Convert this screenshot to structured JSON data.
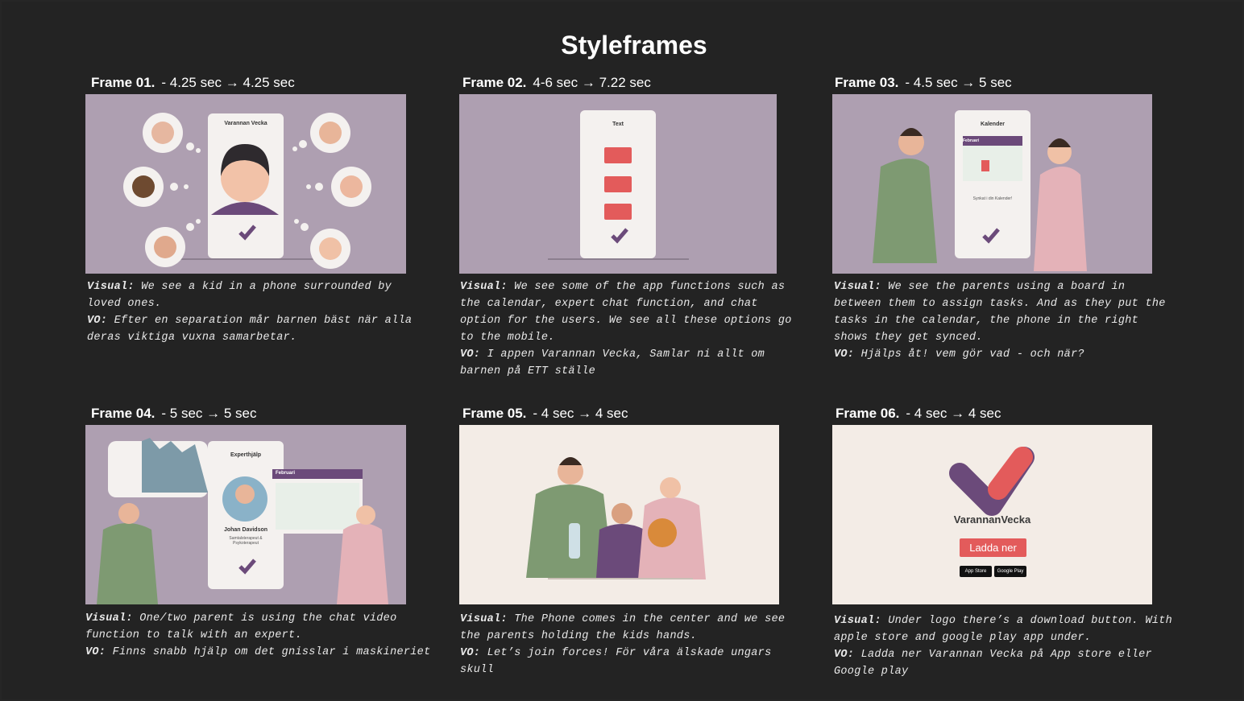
{
  "page": {
    "title": "Styleframes"
  },
  "frames": [
    {
      "number": "Frame 01.",
      "timing": "- 4.25 sec → 4.25 sec",
      "visual_label": "Visual:",
      "visual_text": "We see a kid in a phone surrounded by loved ones.",
      "vo_label": "VO:",
      "vo_text": "Efter en separation mår barnen bäst när alla deras viktiga vuxna samarbetar.",
      "phone_title": "Varannan Vecka"
    },
    {
      "number": "Frame 02.",
      "timing": "4-6 sec → 7.22 sec",
      "visual_label": "Visual:",
      "visual_text": "We see some of the app functions such as the calendar, expert chat function, and chat option for the users. We see all these options go to the mobile.",
      "vo_label": "VO:",
      "vo_text": "I appen Varannan Vecka, Samlar ni allt om barnen på ETT ställe",
      "phone_title": "Text"
    },
    {
      "number": "Frame 03.",
      "timing": "- 4.5 sec → 5 sec",
      "visual_label": "Visual:",
      "visual_text": "We see the parents using a board in between them to assign tasks. And as they put the tasks in the calendar, the phone in the right shows they get synced.",
      "vo_label": "VO:",
      "vo_text": "Hjälps åt! vem gör vad - och när?",
      "phone_title": "Kalender",
      "calendar_month": "Februari",
      "sync_text": "Synkat i din Kalender!"
    },
    {
      "number": "Frame 04.",
      "timing": "- 5 sec → 5 sec",
      "visual_label": "Visual:",
      "visual_text": "One/two parent is using the chat video function to talk with an expert.",
      "vo_label": "VO:",
      "vo_text": "Finns snabb hjälp om det gnisslar i maskineriet",
      "phone_title": "Experthjälp",
      "calendar_month": "Februari",
      "expert_name": "Johan Davidson",
      "expert_role": "Samtalsterapeut & Psykoterapeut"
    },
    {
      "number": "Frame 05.",
      "timing": "- 4 sec  → 4 sec",
      "visual_label": "Visual:",
      "visual_text": "The Phone comes in the center and we see the parents holding the kids hands.",
      "vo_label": "VO:",
      "vo_text": "Let’s join forces! För våra älskade ungars skull"
    },
    {
      "number": "Frame 06.",
      "timing": "- 4 sec → 4 sec",
      "visual_label": "Visual:",
      "visual_text": "Under logo there’s a download button. With apple store and google play app under.",
      "vo_label": "VO:",
      "vo_text": "Ladda ner Varannan Vecka på App store eller Google play",
      "brand_name": "VarannanVecka",
      "download_label": "Ladda ner",
      "app_store_label": "App Store",
      "google_play_label": "Google Play"
    }
  ],
  "colors": {
    "background": "#232323",
    "panel_lilac": "#ae9fb1",
    "panel_cream": "#f3ece6",
    "accent_red": "#e35b5b",
    "brand_purple": "#6b4a7a"
  }
}
